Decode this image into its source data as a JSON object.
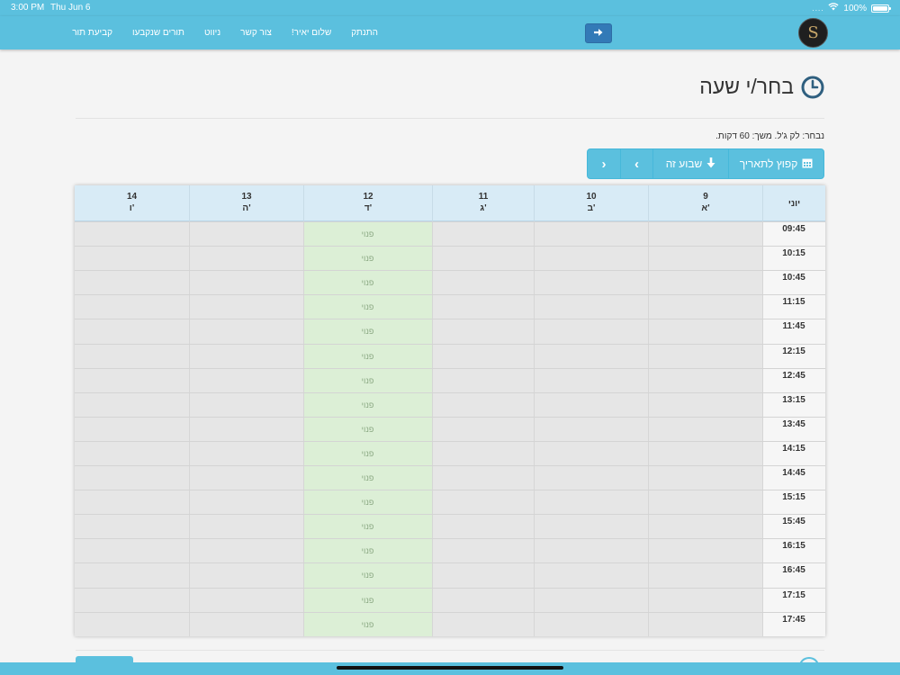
{
  "status_bar": {
    "time": "3:00 PM",
    "date": "Thu Jun 6",
    "signal": "....",
    "battery": "100%"
  },
  "nav": {
    "links": [
      "קביעת תור",
      "תורים שנקבעו",
      "ניווט",
      "צור קשר",
      "שלום יאיר!",
      "התנתק"
    ],
    "logout_icon": "arrow-right-icon",
    "logo_text": "S",
    "logo_icon": "brand-logo"
  },
  "page": {
    "title": "בחר/י שעה",
    "title_icon": "clock-icon",
    "selection": "נבחר: לק ג'ל. משך: 60 דקות."
  },
  "toolbar": {
    "jump_label": "קפוץ לתאריך",
    "jump_icon": "calendar-icon",
    "week_label": "שבוע זה",
    "week_icon": "arrow-down-icon",
    "next_label": "›",
    "prev_label": "‹"
  },
  "calendar": {
    "month_label": "יוני",
    "days": [
      {
        "num": "9",
        "name": "א'",
        "status": "closed"
      },
      {
        "num": "10",
        "name": "ב'",
        "status": "closed"
      },
      {
        "num": "11",
        "name": "ג'",
        "status": "closed"
      },
      {
        "num": "12",
        "name": "ד'",
        "status": "open"
      },
      {
        "num": "13",
        "name": "ה'",
        "status": "closed"
      },
      {
        "num": "14",
        "name": "ו'",
        "status": "closed"
      }
    ],
    "times": [
      "09:45",
      "10:15",
      "10:45",
      "11:15",
      "11:45",
      "12:15",
      "12:45",
      "13:15",
      "13:45",
      "14:15",
      "14:45",
      "15:15",
      "15:45",
      "16:15",
      "16:45",
      "17:15",
      "17:45"
    ],
    "free_label": "פנוי",
    "colors": {
      "open": "#dcefd6",
      "closed": "#e6e6e6",
      "header": "#d8ebf6",
      "accent": "#5bc0de"
    }
  }
}
